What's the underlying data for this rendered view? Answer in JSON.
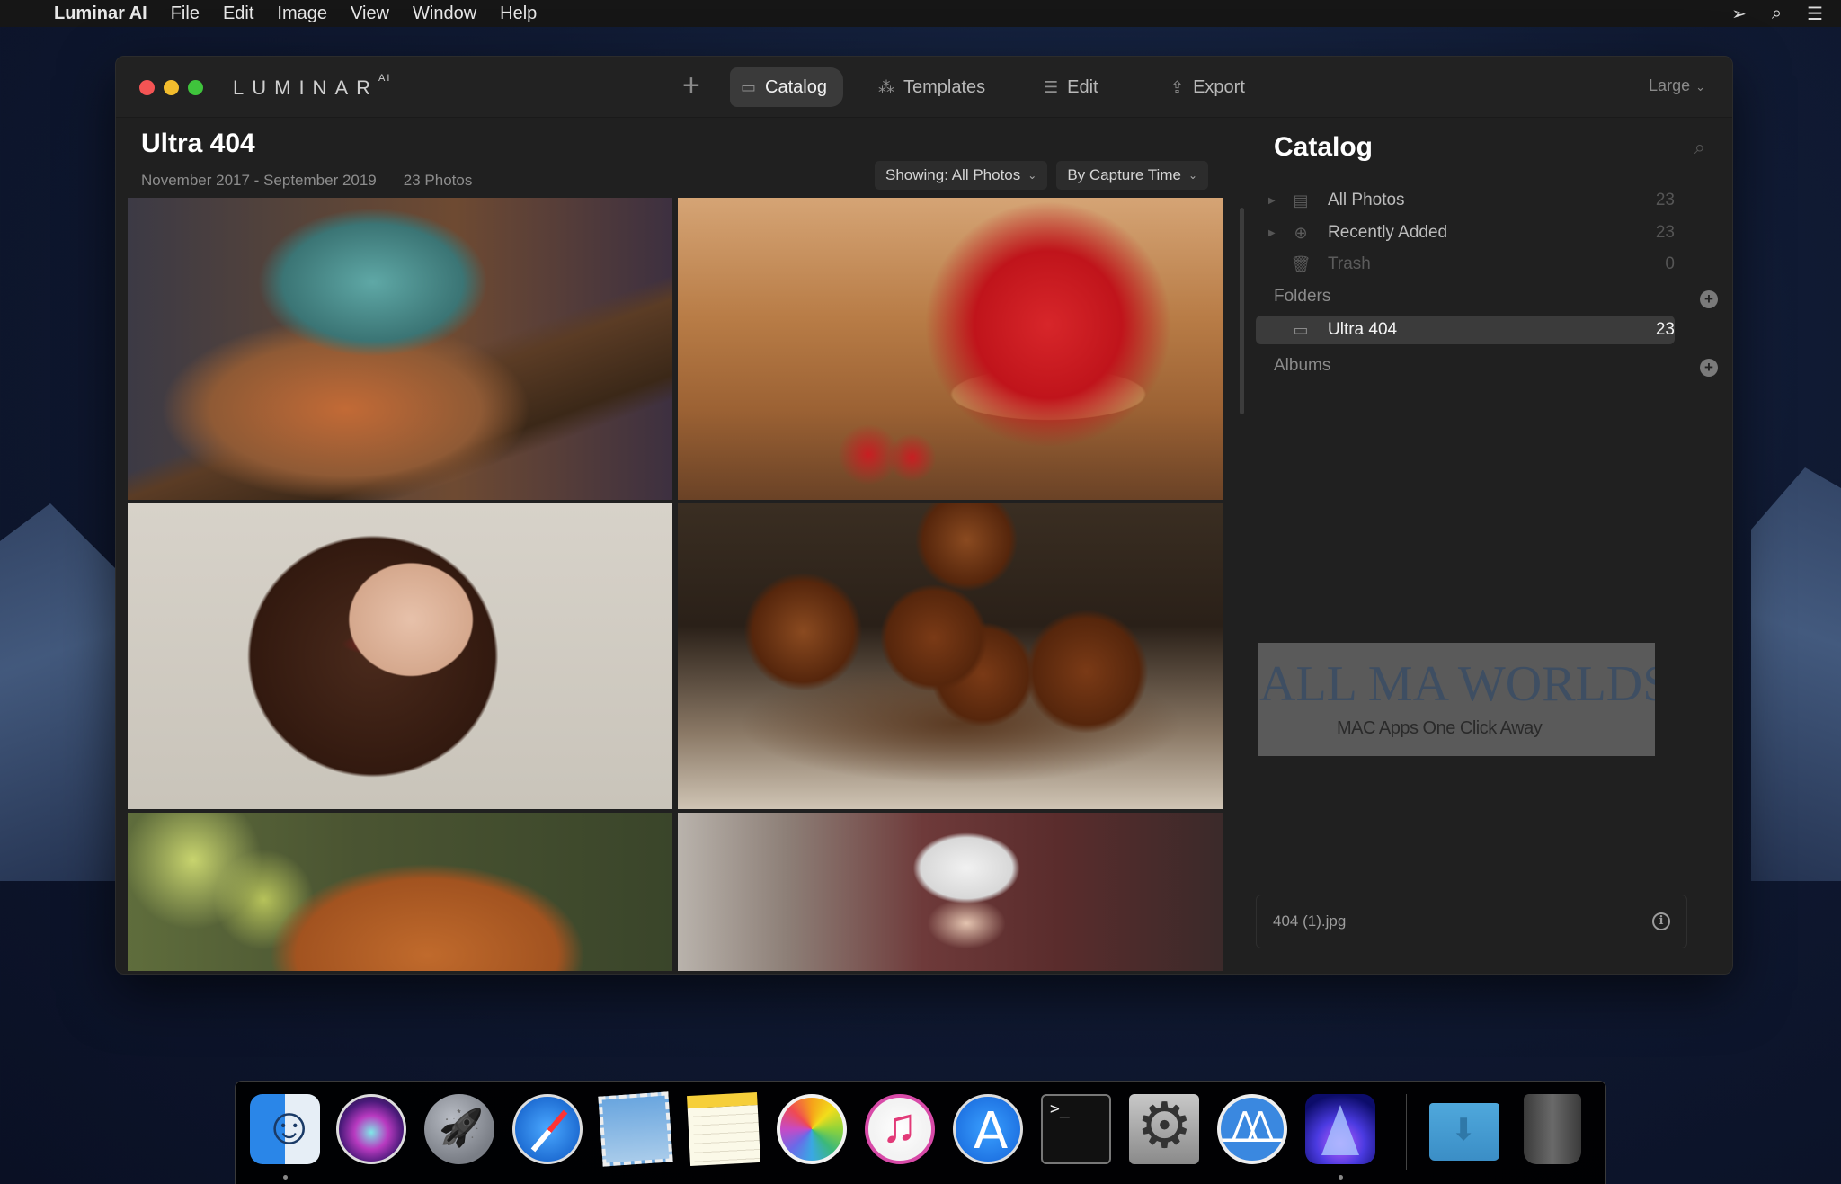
{
  "menubar": {
    "apple_icon": "apple-logo",
    "app_name": "Luminar AI",
    "items": [
      "File",
      "Edit",
      "Image",
      "View",
      "Window",
      "Help"
    ],
    "status_icons": [
      "screenshot-icon",
      "spotlight-search-icon",
      "notification-center-icon"
    ]
  },
  "window": {
    "logo": "LUMINAR",
    "logo_sup": "AI",
    "add_button": "+",
    "tabs": [
      {
        "label": "Catalog",
        "icon": "folder-icon",
        "active": true
      },
      {
        "label": "Templates",
        "icon": "magic-wand-icon",
        "active": false
      },
      {
        "label": "Edit",
        "icon": "sliders-icon",
        "active": false
      },
      {
        "label": "Export",
        "icon": "share-icon",
        "active": false
      }
    ],
    "thumbnail_size": "Large"
  },
  "gallery": {
    "title": "Ultra 404",
    "date_range": "November 2017 - September 2019",
    "photo_count": "23 Photos",
    "filter_showing": "Showing: All Photos",
    "sort_by": "By Capture Time",
    "photos": [
      {
        "subject": "chameleon on branch",
        "selected": true
      },
      {
        "subject": "strawberries in wooden bowl",
        "selected": false
      },
      {
        "subject": "woman applying lipstick",
        "selected": false
      },
      {
        "subject": "burgers on cutting board",
        "selected": false
      },
      {
        "subject": "ginger cat",
        "selected": false
      },
      {
        "subject": "woman in white feather hat",
        "selected": false
      }
    ],
    "accent_color": "#5ab5e6"
  },
  "sidebar": {
    "title": "Catalog",
    "library": [
      {
        "label": "All Photos",
        "count": "23",
        "icon": "stack-icon"
      },
      {
        "label": "Recently Added",
        "count": "23",
        "icon": "clock-plus-icon"
      },
      {
        "label": "Trash",
        "count": "0",
        "icon": "trash-icon"
      }
    ],
    "folders_label": "Folders",
    "folders": [
      {
        "label": "Ultra 404",
        "count": "23",
        "selected": true
      }
    ],
    "albums_label": "Albums",
    "watermark": {
      "main_left": "ALL MA",
      "main_right": "WORLDS",
      "sub": "MAC Apps One Click Away"
    },
    "file_name": "404 (1).jpg"
  },
  "dock": {
    "apps": [
      "Finder",
      "Siri",
      "Launchpad",
      "Safari",
      "Mail",
      "Notes",
      "Photos",
      "Music",
      "App Store",
      "Terminal",
      "System Preferences",
      "Mountain App",
      "Luminar AI",
      "Downloads",
      "Trash"
    ]
  }
}
